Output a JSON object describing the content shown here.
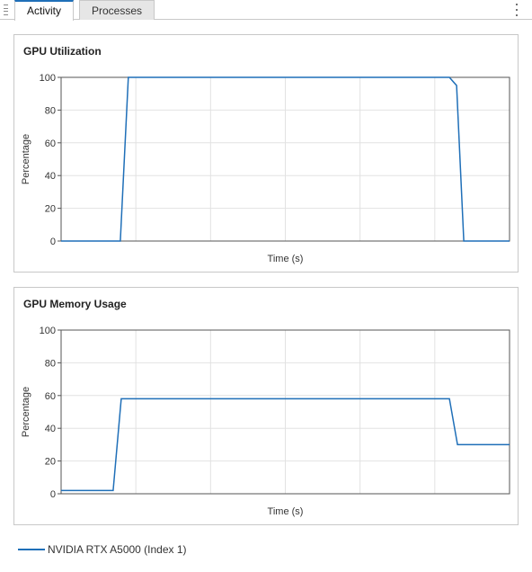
{
  "tabs": [
    {
      "label": "Activity",
      "active": true
    },
    {
      "label": "Processes",
      "active": false
    }
  ],
  "accent_color": "#1f6fb8",
  "charts": [
    {
      "title": "GPU Utilization"
    },
    {
      "title": "GPU Memory Usage"
    }
  ],
  "legend": {
    "label": "NVIDIA RTX A5000 (Index 1)",
    "color": "#1f6fb8"
  },
  "chart_data": [
    {
      "type": "line",
      "title": "GPU Utilization",
      "xlabel": "Time (s)",
      "ylabel": "Percentage",
      "xlim": [
        0,
        100
      ],
      "ylim": [
        0,
        100
      ],
      "yticks": [
        0,
        20,
        40,
        60,
        80,
        100
      ],
      "grid": true,
      "series": [
        {
          "name": "NVIDIA RTX A5000 (Index 1)",
          "color": "#1f6fb8",
          "x": [
            0,
            13.2,
            15,
            86.6,
            88.2,
            89.8,
            100
          ],
          "y": [
            0,
            0,
            100,
            100,
            95,
            0,
            0
          ]
        }
      ]
    },
    {
      "type": "line",
      "title": "GPU Memory Usage",
      "xlabel": "Time (s)",
      "ylabel": "Percentage",
      "xlim": [
        0,
        100
      ],
      "ylim": [
        0,
        100
      ],
      "yticks": [
        0,
        20,
        40,
        60,
        80,
        100
      ],
      "grid": true,
      "series": [
        {
          "name": "NVIDIA RTX A5000 (Index 1)",
          "color": "#1f6fb8",
          "x": [
            0,
            11.6,
            13.4,
            86.6,
            88.4,
            100
          ],
          "y": [
            2,
            2,
            58,
            58,
            30,
            30
          ]
        }
      ]
    }
  ]
}
